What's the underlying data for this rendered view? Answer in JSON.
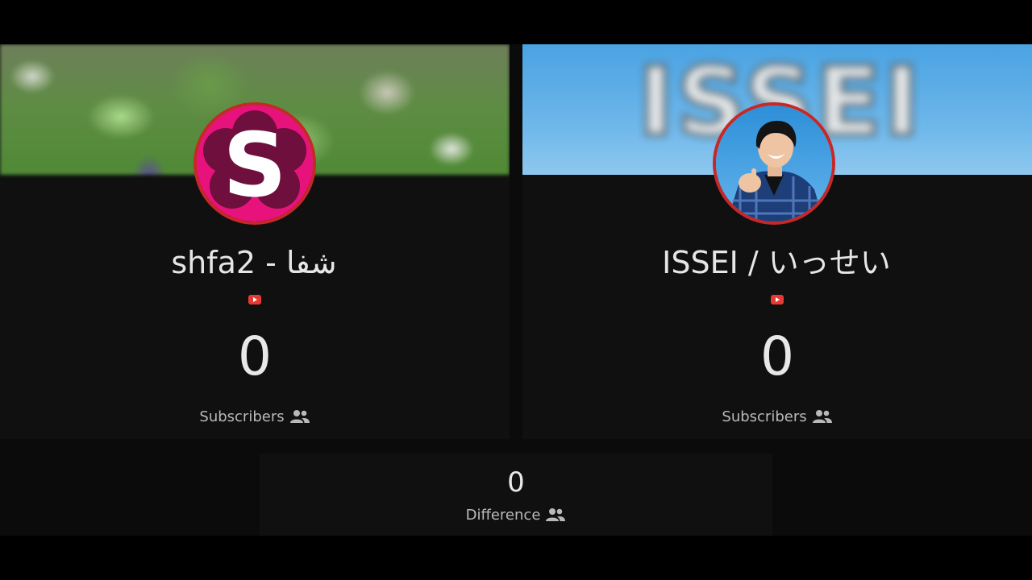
{
  "channels": [
    {
      "name": "shfa2 - شفا",
      "platform_icon": "youtube-icon",
      "subscriber_count": "0",
      "subscriber_label": "Subscribers",
      "avatar_icon": "letter-s-flower-logo",
      "avatar_letter": "S",
      "banner": "blurred-green-foliage-photo"
    },
    {
      "name": "ISSEI / いっせい",
      "platform_icon": "youtube-icon",
      "subscriber_count": "0",
      "subscriber_label": "Subscribers",
      "avatar_icon": "person-pointing-photo",
      "banner": "blurred-blue-sky-logo-banner",
      "banner_text": "ISSEI"
    }
  ],
  "difference": {
    "value": "0",
    "label": "Difference"
  },
  "colors": {
    "avatar_border": "#c62828",
    "youtube_red": "#e53935",
    "card_background": "#101010",
    "text_primary": "#e8e8e8",
    "text_secondary": "#b9b9b9"
  }
}
